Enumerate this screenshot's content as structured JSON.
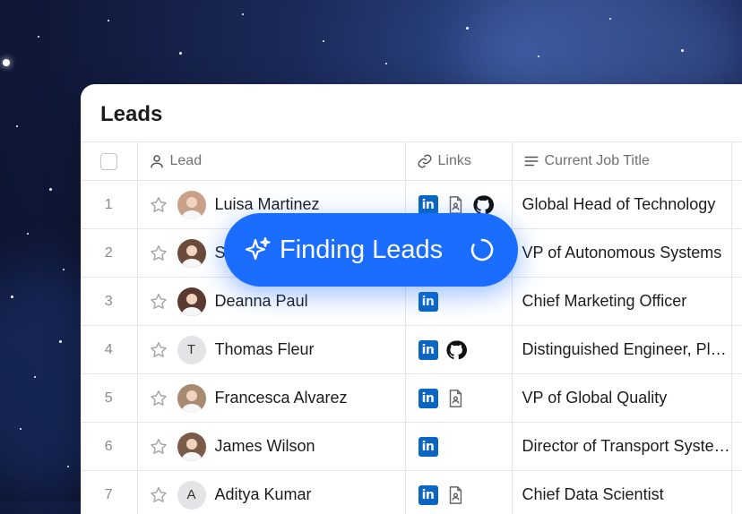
{
  "card": {
    "title": "Leads"
  },
  "columns": {
    "lead": "Lead",
    "links": "Links",
    "job": "Current Job Title"
  },
  "rows": [
    {
      "index": "1",
      "name": "Luisa Martinez",
      "avatar": "photo",
      "avatar_color": "#c9a08a",
      "initial": "",
      "links": [
        "linkedin",
        "resume",
        "github"
      ],
      "job": "Global Head of Technology"
    },
    {
      "index": "2",
      "name": "S",
      "avatar": "photo",
      "avatar_color": "#6a4a3a",
      "initial": "",
      "links": [],
      "job": "VP of Autonomous Systems"
    },
    {
      "index": "3",
      "name": "Deanna Paul",
      "avatar": "photo",
      "avatar_color": "#5a3a30",
      "initial": "",
      "links": [
        "linkedin"
      ],
      "job": "Chief Marketing Officer"
    },
    {
      "index": "4",
      "name": "Thomas Fleur",
      "avatar": "initial",
      "avatar_color": "#e4e4e6",
      "initial": "T",
      "links": [
        "linkedin",
        "github"
      ],
      "job": "Distinguished Engineer, Platform"
    },
    {
      "index": "5",
      "name": "Francesca Alvarez",
      "avatar": "photo",
      "avatar_color": "#a88a70",
      "initial": "",
      "links": [
        "linkedin",
        "resume"
      ],
      "job": "VP of Global Quality"
    },
    {
      "index": "6",
      "name": "James Wilson",
      "avatar": "photo",
      "avatar_color": "#7a5a48",
      "initial": "",
      "links": [
        "linkedin"
      ],
      "job": "Director of Transport Systems"
    },
    {
      "index": "7",
      "name": "Aditya Kumar",
      "avatar": "initial",
      "avatar_color": "#e4e4e6",
      "initial": "A",
      "links": [
        "linkedin",
        "resume"
      ],
      "job": "Chief Data Scientist"
    }
  ],
  "overlay": {
    "label": "Finding Leads",
    "icon": "sparkle-icon",
    "status_icon": "spinner-icon"
  },
  "colors": {
    "accent": "#1a6dff",
    "linkedin": "#0a66c2"
  }
}
